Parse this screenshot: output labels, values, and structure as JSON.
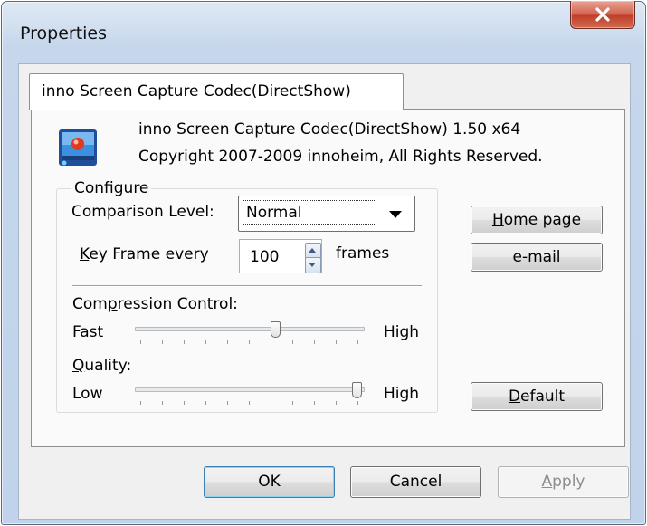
{
  "window": {
    "title": "Properties"
  },
  "tab": {
    "label": "inno Screen Capture Codec(DirectShow)"
  },
  "info": {
    "line1": "inno Screen Capture Codec(DirectShow) 1.50 x64",
    "line2": "Copyright 2007-2009 innoheim, All Rights Reserved."
  },
  "configure": {
    "group_label": "Configure",
    "comparison_label": "Comparison Level:",
    "comparison_value": "Normal",
    "keyframe_label_prefix": "K",
    "keyframe_label_rest": "ey Frame every",
    "keyframe_value": "100",
    "keyframe_unit": "frames",
    "compression_label_a": "Com",
    "compression_label_u": "p",
    "compression_label_b": "ression Control:",
    "compression_min": "Fast",
    "compression_max": "High",
    "compression_level": 0.62,
    "quality_label_u": "Q",
    "quality_label_rest": "uality:",
    "quality_min": "Low",
    "quality_max": "High",
    "quality_level": 1.0
  },
  "side_buttons": {
    "home_u": "H",
    "home_rest": "ome page",
    "email_u": "e",
    "email_rest": "-mail",
    "default_u": "D",
    "default_rest": "efault"
  },
  "footer": {
    "ok": "OK",
    "cancel": "Cancel",
    "apply_u": "A",
    "apply_rest": "pply"
  },
  "colors": {
    "close_button": "#c8503a",
    "frame": "#c6d7ec",
    "default_button_border": "#3c7fb1"
  },
  "icons": {
    "close": "close-x-icon",
    "app": "codec-app-icon",
    "dropdown": "chevron-down-icon"
  }
}
